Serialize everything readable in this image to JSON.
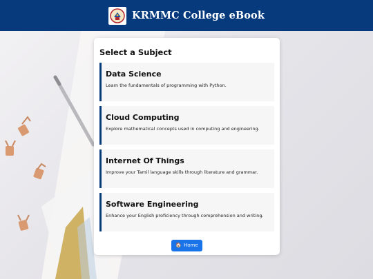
{
  "header": {
    "title": "KRMMC College eBook",
    "logo_icon": "college-crest-icon"
  },
  "main": {
    "heading": "Select a Subject",
    "subjects": [
      {
        "name": "Data Science",
        "description": "Learn the fundamentals of programming with Python."
      },
      {
        "name": "Cloud Computing",
        "description": "Explore mathematical concepts used in computing and engineering."
      },
      {
        "name": "Internet Of Things",
        "description": "Improve your Tamil language skills through literature and grammar."
      },
      {
        "name": "Software Engineering",
        "description": "Enhance your English proficiency through comprehension and writing."
      }
    ],
    "home_button": {
      "label": "Home",
      "icon": "house-icon"
    }
  },
  "colors": {
    "header_bg": "#063a7d",
    "accent_border": "#063a7d",
    "button_bg": "#1a73e8"
  }
}
